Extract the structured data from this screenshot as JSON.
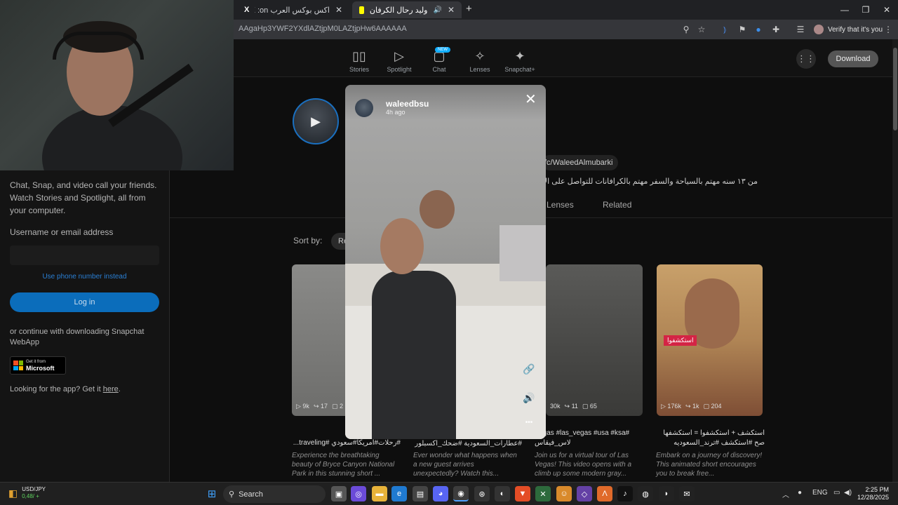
{
  "browser": {
    "tabs": [
      {
        "label": "اكس بوكس العرب X :on\"بعد شه"
      },
      {
        "label": "وليد رحال الكرفان & Lenses"
      }
    ],
    "add_tab": "+",
    "url": "AAgaHp3YWF2YXdlAZtjpM0LAZtjpHw6AAAAAA",
    "verify_label": "Verify that it's you",
    "window_min": "—",
    "window_restore": "❐",
    "window_close": "✕"
  },
  "snap_nav": {
    "items": [
      {
        "label": "Stories",
        "icon": "stories-icon"
      },
      {
        "label": "Spotlight",
        "icon": "spotlight-icon"
      },
      {
        "label": "Chat",
        "icon": "chat-icon"
      },
      {
        "label": "Lenses",
        "icon": "lenses-icon"
      },
      {
        "label": "Snapchat+",
        "icon": "snapchat-plus-icon"
      }
    ],
    "new_badge": "NEW",
    "download_label": "Download"
  },
  "left_panel": {
    "intro": "Chat, Snap, and video call your friends. Watch Stories and Spotlight, all from your computer.",
    "username_label": "Username or email address",
    "phone_link": "Use phone number instead",
    "login_label": "Log in",
    "continue_text": "or continue with downloading Snapchat WebApp",
    "ms_get": "Get it from",
    "ms_name": "Microsoft",
    "app_text": "Looking for the app? Get it",
    "app_link": "here",
    "app_end": "."
  },
  "profile": {
    "handle": "/c/WaleedAlmubarki",
    "bio": "من ١٣ سنه مهتم بالسياحة والسفر مهتم بالكرافانات للتواصل على الإيميل us",
    "tabs": [
      "Lenses",
      "Related"
    ],
    "sort_label": "Sort by:",
    "sort_value": "Re"
  },
  "cards": [
    {
      "views": "9k",
      "shares": "17",
      "comments": "2",
      "title": "سبحان الخالق #رحلات#امريكا#سعودي #traveling...",
      "desc": "Experience the breathtaking beauty of Bryce Canyon National Park in this stunning short ..."
    },
    {
      "views": "",
      "shares": "",
      "comments": "",
      "title": "#ﻋﻄﺎﺭﺍﺕ_السعودية #ضحك_اكسبلور",
      "desc": "Ever wonder what happens when a new guest arrives unexpectedly? Watch this..."
    },
    {
      "views": "30k",
      "shares": "11",
      "comments": "65",
      "title": "Vegas #las_vegas #usa #ksa# لاس_فيقاس",
      "desc": "Join us for a virtual tour of Las Vegas! This video opens with a climb up some modern gray..."
    },
    {
      "views": "176k",
      "shares": "1k",
      "comments": "204",
      "title": "استكشف + استكشفوا = استكشفها صح #استكشف #ترند_السعوديه #امريكا ...",
      "desc": "Embark on a journey of discovery! This animated short encourages you to break free..."
    }
  ],
  "card4_badge": "استكشفوا",
  "modal": {
    "username": "waleedbsu",
    "time": "4h ago",
    "close": "✕",
    "link": "🔗",
    "sound": "🔊",
    "more": "•••"
  },
  "taskbar": {
    "stock_symbol": "USD/JPY",
    "stock_value": "0,48/ +",
    "search_label": "Search",
    "lang": "ENG",
    "time": "2:25 PM",
    "date": "12/28/2025"
  }
}
